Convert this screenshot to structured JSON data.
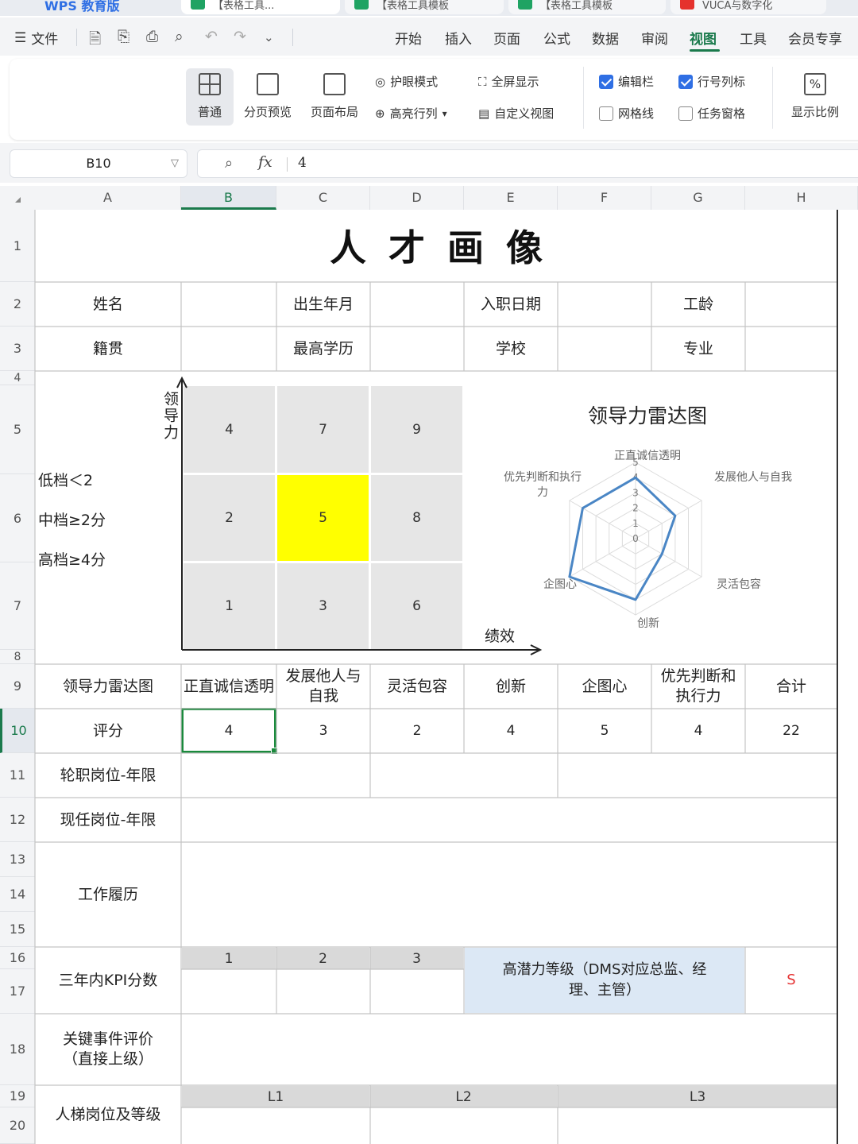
{
  "tabs": [
    {
      "label": "WPS 教育版"
    },
    {
      "label": "【表格工具..."
    },
    {
      "label": "【表格工具模板"
    },
    {
      "label": "【表格工具模板"
    },
    {
      "label": "VUCA与数字化"
    }
  ],
  "menu": {
    "file_label": "文件",
    "items": [
      "开始",
      "插入",
      "页面",
      "公式",
      "数据",
      "审阅",
      "视图",
      "工具",
      "会员专享"
    ],
    "active": "视图"
  },
  "ribbon": {
    "normal": "普通",
    "page_break": "分页预览",
    "page_layout": "页面布局",
    "eye_mode": "护眼模式",
    "highlight": "高亮行列",
    "fullscreen": "全屏显示",
    "custom_view": "自定义视图",
    "formula_bar": "编辑栏",
    "formula_bar_checked": true,
    "headers": "行号列标",
    "headers_checked": true,
    "gridlines": "网格线",
    "gridlines_checked": false,
    "task_pane": "任务窗格",
    "task_pane_checked": false,
    "zoom": "显示比例"
  },
  "formula": {
    "cell_ref": "B10",
    "fx": "fx",
    "value": "4"
  },
  "columns": [
    "A",
    "B",
    "C",
    "D",
    "E",
    "F",
    "G",
    "H"
  ],
  "rows": [
    "1",
    "2",
    "3",
    "4",
    "5",
    "6",
    "7",
    "8",
    "9",
    "10",
    "11",
    "12",
    "13",
    "14",
    "15",
    "16",
    "17",
    "18",
    "19",
    "20"
  ],
  "sheet": {
    "title": "人才画像",
    "r2": [
      "姓名",
      "出生年月",
      "入职日期",
      "工龄"
    ],
    "r3": [
      "籍贯",
      "最高学历",
      "学校",
      "专业"
    ],
    "legend": [
      "低档＜2",
      "中档≥2分",
      "高档≥4分"
    ],
    "axis_y": "领导力",
    "axis_x": "绩效",
    "grid": [
      [
        "4",
        "7",
        "9"
      ],
      [
        "2",
        "5",
        "8"
      ],
      [
        "1",
        "3",
        "6"
      ]
    ],
    "r9": [
      "领导力雷达图",
      "正直诚信透明",
      "发展他人与自我",
      "灵活包容",
      "创新",
      "企图心",
      "优先判断和执行力",
      "合计"
    ],
    "r10": [
      "评分",
      "4",
      "3",
      "2",
      "4",
      "5",
      "4",
      "22"
    ],
    "r11": "轮职岗位-年限",
    "r12": "现任岗位-年限",
    "r13": "工作履历",
    "kpi_label": "三年内KPI分数",
    "kpi_years": [
      "1",
      "2",
      "3"
    ],
    "potential_label": "高潜力等级（DMS对应总监、经理、主管）",
    "potential_value": "S",
    "key_events": "关键事件评价（直接上级）",
    "ladder_label": "人梯岗位及等级",
    "ladder_levels": [
      "L1",
      "L2",
      "L3"
    ]
  },
  "chart_data": {
    "type": "radar",
    "title": "领导力雷达图",
    "categories": [
      "正直诚信透明",
      "发展他人与自我",
      "灵活包容",
      "创新",
      "企图心",
      "优先判断和执行力"
    ],
    "values": [
      4,
      3,
      2,
      4,
      5,
      4
    ],
    "rlim": [
      0,
      5
    ],
    "ticks": [
      "0",
      "1",
      "2",
      "3",
      "4",
      "5"
    ],
    "color": "#4a86c5"
  }
}
